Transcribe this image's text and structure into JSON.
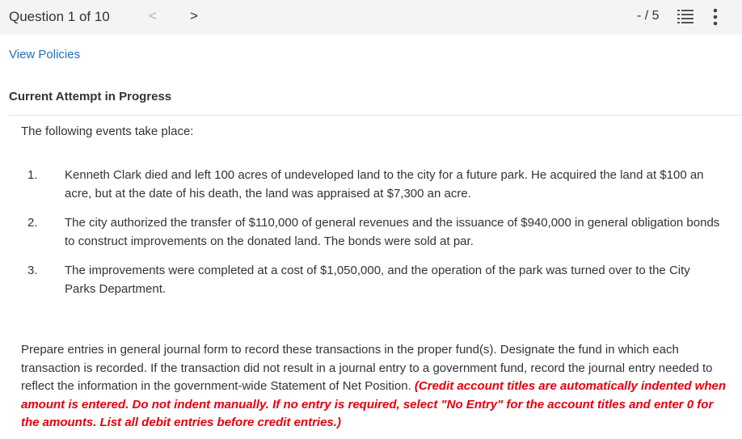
{
  "header": {
    "question_label": "Question 1 of 10",
    "prev_glyph": "<",
    "next_glyph": ">",
    "score": "- / 5",
    "list_icon": "list-icon",
    "more_icon": "more-vertical-icon"
  },
  "policies_link": "View Policies",
  "attempt_status": "Current Attempt in Progress",
  "question": {
    "intro": "The following events take place:",
    "events": [
      {
        "num": "1.",
        "text": "Kenneth Clark died and left 100 acres of undeveloped land to the city for a future park. He acquired the land at $100 an acre, but at the date of his death, the land was appraised at $7,300 an acre."
      },
      {
        "num": "2.",
        "text": "The city authorized the transfer of $110,000 of general revenues and the issuance of $940,000 in general obligation bonds to construct improvements on the donated land. The bonds were sold at par."
      },
      {
        "num": "3.",
        "text": "The improvements were completed at a cost of $1,050,000, and the operation of the park was turned over to the City Parks Department."
      }
    ],
    "instructions": "Prepare entries in general journal form to record these transactions in the proper fund(s). Designate the fund in which each transaction is recorded. If the transaction did not result in a journal entry to a government fund, record the journal entry needed to reflect the information in the government-wide Statement of Net Position.",
    "note": "(Credit account titles are automatically indented when amount is entered. Do not indent manually. If no entry is required, select \"No Entry\" for the account titles and enter 0 for the amounts. List all debit entries before credit entries.)"
  },
  "colors": {
    "link": "#1f6fb2",
    "note_red": "#e3000f",
    "topbar_bg": "#f4f4f4"
  }
}
